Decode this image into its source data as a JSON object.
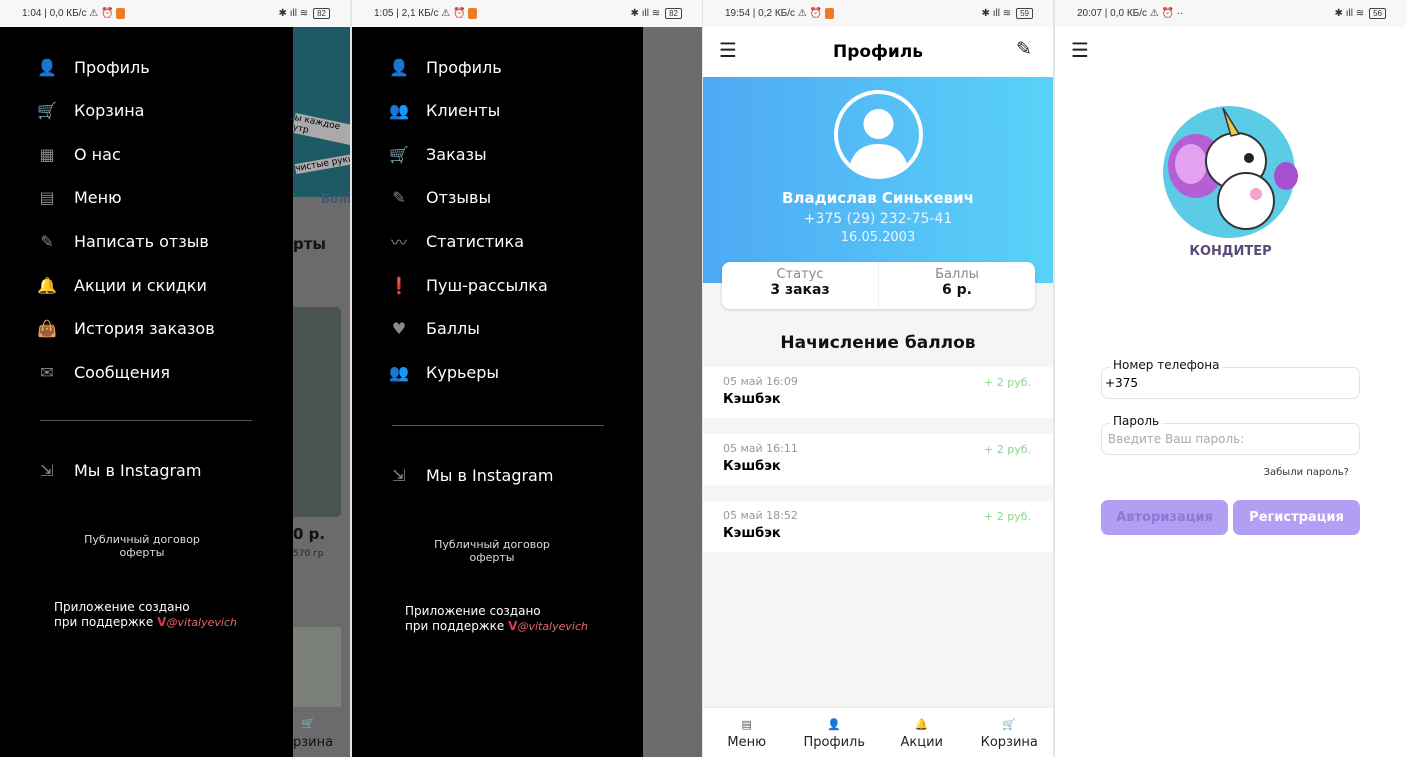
{
  "screens": [
    {
      "status": {
        "time": "1:04 | 0,0 КБ/с",
        "battery": "82"
      },
      "menu": [
        {
          "icon": "person-icon",
          "glyph": "👤",
          "label": "Профиль"
        },
        {
          "icon": "cart-icon",
          "glyph": "🛒",
          "label": "Корзина"
        },
        {
          "icon": "store-icon",
          "glyph": "▦",
          "label": "О нас"
        },
        {
          "icon": "menu-book-icon",
          "glyph": "▤",
          "label": "Меню"
        },
        {
          "icon": "pencil-icon",
          "glyph": "✎",
          "label": "Написать отзыв"
        },
        {
          "icon": "bell-icon",
          "glyph": "🔔",
          "label": "Акции и скидки"
        },
        {
          "icon": "bag-icon",
          "glyph": "👜",
          "label": "История заказов"
        },
        {
          "icon": "message-icon",
          "glyph": "✉",
          "label": "Сообщения"
        }
      ],
      "instagram": "Мы в Instagram",
      "contract": [
        "Публичный договор",
        "оферты"
      ],
      "credit": [
        "Приложение создано",
        "при поддержке"
      ],
      "handle": "@vitalyevich",
      "bg_texts": [
        "ы каждое утр",
        "чистые руки",
        "Боль",
        "рты",
        "0 р.",
        "570 гр",
        "рзина"
      ]
    },
    {
      "status": {
        "time": "1:05 | 2,1 КБ/с",
        "battery": "82"
      },
      "menu": [
        {
          "icon": "person-icon",
          "glyph": "👤",
          "label": "Профиль"
        },
        {
          "icon": "people-icon",
          "glyph": "👥",
          "label": "Клиенты"
        },
        {
          "icon": "cart-icon",
          "glyph": "🛒",
          "label": "Заказы"
        },
        {
          "icon": "pencil-icon",
          "glyph": "✎",
          "label": "Отзывы"
        },
        {
          "icon": "chart-line-icon",
          "glyph": "〰",
          "label": "Статистика"
        },
        {
          "icon": "announcement-icon",
          "glyph": "❗",
          "label": "Пуш-рассылка"
        },
        {
          "icon": "hand-heart-icon",
          "glyph": "♥",
          "label": "Баллы"
        },
        {
          "icon": "people-icon",
          "glyph": "👥",
          "label": "Курьеры"
        }
      ],
      "instagram": "Мы в Instagram",
      "contract": [
        "Публичный договор",
        "оферты"
      ],
      "credit": [
        "Приложение создано",
        "при поддержке"
      ],
      "handle": "@vitalyevich"
    },
    {
      "status": {
        "time": "19:54 | 0,2 КБ/с",
        "battery": "59"
      },
      "title": "Профиль",
      "name": "Владислав Синькевич",
      "phone": "+375 (29) 232-75-41",
      "birthdate": "16.05.2003",
      "stats": [
        {
          "label": "Статус",
          "value": "3 заказ"
        },
        {
          "label": "Баллы",
          "value": "6 р."
        }
      ],
      "section": "Начисление баллов",
      "transactions": [
        {
          "date": "05 май 16:09",
          "amount": "+ 2 руб.",
          "type": "Кэшбэк"
        },
        {
          "date": "05 май 16:11",
          "amount": "+ 2 руб.",
          "type": "Кэшбэк"
        },
        {
          "date": "05 май 18:52",
          "amount": "+ 2 руб.",
          "type": "Кэшбэк"
        }
      ],
      "nav": [
        {
          "icon": "menu-book-icon",
          "label": "Меню"
        },
        {
          "icon": "person-icon",
          "label": "Профиль"
        },
        {
          "icon": "bell-icon",
          "label": "Акции"
        },
        {
          "icon": "cart-icon",
          "label": "Корзина"
        }
      ],
      "accent": "#4ea9f4"
    },
    {
      "status": {
        "time": "20:07 | 0,0 КБ/с",
        "battery": "56"
      },
      "brand": "КОНДИТЕР",
      "phone_label": "Номер телефона",
      "phone_value": "+375",
      "password_label": "Пароль",
      "password_placeholder": "Введите Ваш пароль:",
      "forgot": "Забыли пароль?",
      "login": "Авторизация",
      "register": "Регистрация",
      "accent": "#b39ef5"
    }
  ]
}
